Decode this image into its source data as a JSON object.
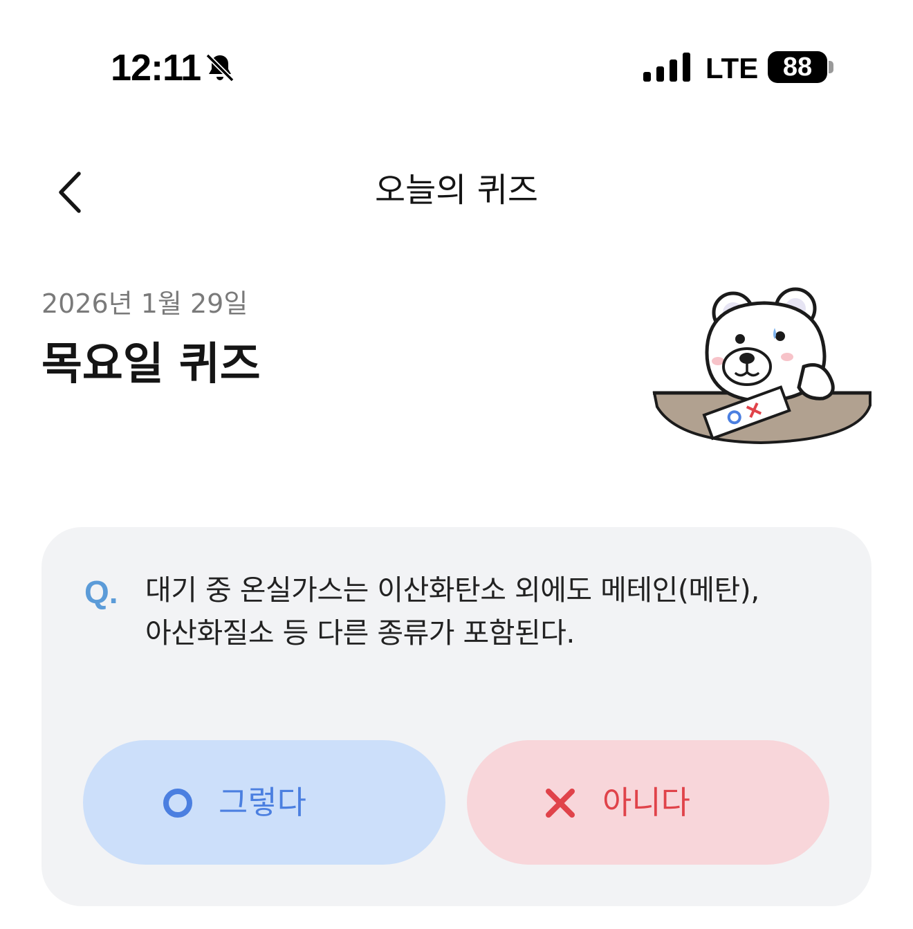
{
  "status_bar": {
    "time": "12:11",
    "silent_icon": "bell-slash-icon",
    "signal_icon": "cellular-signal-icon",
    "network": "LTE",
    "battery": "88"
  },
  "nav": {
    "back_icon": "chevron-left-icon",
    "title": "오늘의 퀴즈"
  },
  "header": {
    "date": "2026년 1월 29일",
    "title": "목요일 퀴즈",
    "illustration": "polar-bear-quiz-illustration"
  },
  "quiz": {
    "marker": "Q.",
    "question_line1": "대기 중 온실가스는 이산화탄소 외에도 메테인(메탄),",
    "question_line2": "아산화질소 등 다른 종류가 포함된다.",
    "answers": [
      {
        "label": "그렇다",
        "icon": "circle-o-icon",
        "color": "#4b7fe0",
        "background": "#ccdffa"
      },
      {
        "label": "아니다",
        "icon": "x-mark-icon",
        "color": "#e0434a",
        "background": "#f8d6da"
      }
    ]
  }
}
